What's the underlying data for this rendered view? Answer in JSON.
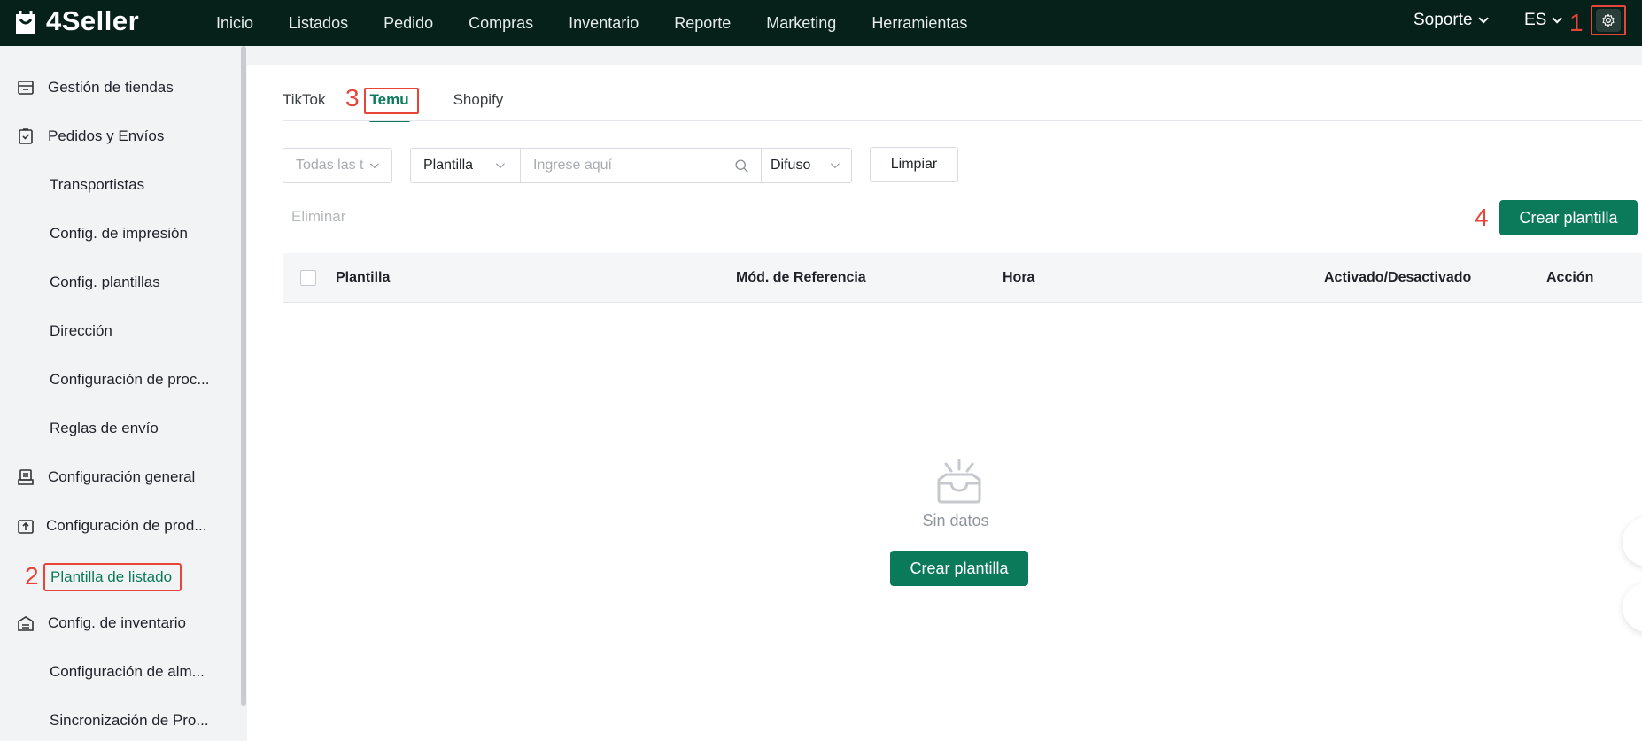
{
  "brand": {
    "name": "4Seller",
    "accent": "#0b7a5a",
    "topbar_bg": "#06201a",
    "annotation_color": "#e8443a"
  },
  "nav": {
    "items": [
      "Inicio",
      "Listados",
      "Pedido",
      "Compras",
      "Inventario",
      "Reporte",
      "Marketing",
      "Herramientas"
    ]
  },
  "topright": {
    "support": "Soporte",
    "lang": "ES",
    "settings_icon": "gear-icon"
  },
  "annotations": {
    "a1": "1",
    "a2": "2",
    "a3": "3",
    "a4": "4"
  },
  "sidebar": {
    "items": [
      {
        "label": "Gestión de tiendas",
        "icon": "store-icon"
      },
      {
        "label": "Pedidos y Envíos",
        "icon": "clipboard-check-icon"
      },
      {
        "label": "Transportistas"
      },
      {
        "label": "Config. de impresión"
      },
      {
        "label": "Config. plantillas"
      },
      {
        "label": "Dirección"
      },
      {
        "label": "Configuración de proc..."
      },
      {
        "label": "Reglas de envío"
      },
      {
        "label": "Configuración general",
        "icon": "printer-icon"
      },
      {
        "label": "Configuración de prod...",
        "icon": "upload-box-icon"
      },
      {
        "label": "Plantilla de listado",
        "active": true
      },
      {
        "label": "Config. de inventario",
        "icon": "warehouse-icon"
      },
      {
        "label": "Configuración de alm..."
      },
      {
        "label": "Sincronización de Pro..."
      }
    ]
  },
  "tabs": {
    "items": [
      "TikTok",
      "Temu",
      "Shopify"
    ],
    "active": "Temu"
  },
  "filters": {
    "store_placeholder": "Todas las t",
    "field_select": "Plantilla",
    "search_placeholder": "Ingrese aquí",
    "match_select": "Difuso",
    "clear_label": "Limpiar"
  },
  "toolbar": {
    "delete_label": "Eliminar",
    "create_label": "Crear plantilla"
  },
  "table": {
    "columns": [
      "Plantilla",
      "Mód. de Referencia",
      "Hora",
      "Activado/Desactivado",
      "Acción"
    ],
    "rows": []
  },
  "empty": {
    "text": "Sin datos",
    "create_label": "Crear plantilla"
  }
}
